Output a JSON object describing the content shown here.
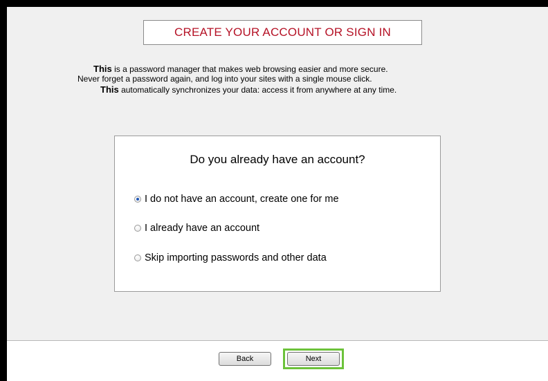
{
  "header": {
    "title": "CREATE YOUR ACCOUNT OR SIGN IN"
  },
  "intro": {
    "line1_bold": "This",
    "line1_rest": " is a password manager that makes web browsing easier and more secure.",
    "line2": "Never forget a password again, and log into your sites with a single mouse click.",
    "line3_bold": "This",
    "line3_rest": " automatically synchronizes your data: access it from anywhere at any time."
  },
  "account_card": {
    "question": "Do you already have an account?",
    "options": [
      {
        "label": "I do not have an account, create one for me",
        "selected": true
      },
      {
        "label": "I already have an account",
        "selected": false
      },
      {
        "label": "Skip importing passwords and other data",
        "selected": false
      }
    ]
  },
  "footer": {
    "back_label": "Back",
    "next_label": "Next",
    "highlight_color": "#6cc23a"
  },
  "colors": {
    "title_red": "#b51226",
    "background": "#f0f0f0"
  }
}
